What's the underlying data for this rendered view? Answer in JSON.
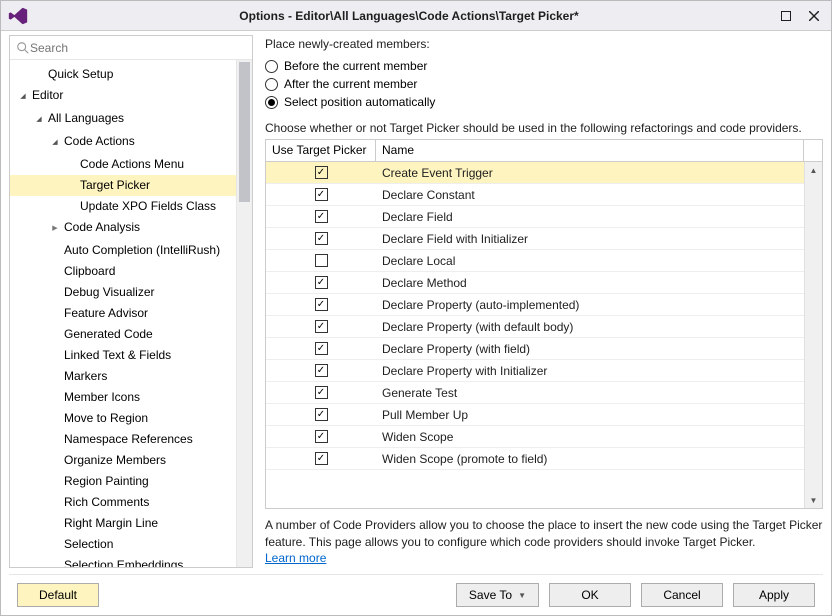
{
  "window": {
    "title": "Options - Editor\\All Languages\\Code Actions\\Target Picker*"
  },
  "search": {
    "placeholder": "Search"
  },
  "tree": {
    "items": [
      {
        "label": "Quick Setup",
        "depth": 1,
        "caret": "none"
      },
      {
        "label": "Editor",
        "depth": 0,
        "caret": "open"
      },
      {
        "label": "All Languages",
        "depth": 1,
        "caret": "open"
      },
      {
        "label": "Code Actions",
        "depth": 2,
        "caret": "open"
      },
      {
        "label": "Code Actions Menu",
        "depth": 3,
        "caret": "none"
      },
      {
        "label": "Target Picker",
        "depth": 3,
        "caret": "none",
        "selected": true
      },
      {
        "label": "Update XPO Fields Class",
        "depth": 3,
        "caret": "none"
      },
      {
        "label": "Code Analysis",
        "depth": 2,
        "caret": "closed"
      },
      {
        "label": "Auto Completion (IntelliRush)",
        "depth": 2,
        "caret": "none"
      },
      {
        "label": "Clipboard",
        "depth": 2,
        "caret": "none"
      },
      {
        "label": "Debug Visualizer",
        "depth": 2,
        "caret": "none"
      },
      {
        "label": "Feature Advisor",
        "depth": 2,
        "caret": "none"
      },
      {
        "label": "Generated Code",
        "depth": 2,
        "caret": "none"
      },
      {
        "label": "Linked Text & Fields",
        "depth": 2,
        "caret": "none"
      },
      {
        "label": "Markers",
        "depth": 2,
        "caret": "none"
      },
      {
        "label": "Member Icons",
        "depth": 2,
        "caret": "none"
      },
      {
        "label": "Move to Region",
        "depth": 2,
        "caret": "none"
      },
      {
        "label": "Namespace References",
        "depth": 2,
        "caret": "none"
      },
      {
        "label": "Organize Members",
        "depth": 2,
        "caret": "none"
      },
      {
        "label": "Region Painting",
        "depth": 2,
        "caret": "none"
      },
      {
        "label": "Rich Comments",
        "depth": 2,
        "caret": "none"
      },
      {
        "label": "Right Margin Line",
        "depth": 2,
        "caret": "none"
      },
      {
        "label": "Selection",
        "depth": 2,
        "caret": "none"
      },
      {
        "label": "Selection Embeddings",
        "depth": 2,
        "caret": "none"
      }
    ]
  },
  "right": {
    "placement_label": "Place newly-created members:",
    "radios": [
      {
        "label": "Before the current member",
        "checked": false
      },
      {
        "label": "After the current member",
        "checked": false
      },
      {
        "label": "Select position automatically",
        "checked": true
      }
    ],
    "choose_label": "Choose whether or not Target Picker should be used in the following refactorings and code providers.",
    "grid": {
      "col_use": "Use Target Picker",
      "col_name": "Name",
      "rows": [
        {
          "name": "Create Event Trigger",
          "checked": true,
          "selected": true
        },
        {
          "name": "Declare Constant",
          "checked": true
        },
        {
          "name": "Declare Field",
          "checked": true
        },
        {
          "name": "Declare Field with Initializer",
          "checked": true
        },
        {
          "name": "Declare Local",
          "checked": false
        },
        {
          "name": "Declare Method",
          "checked": true
        },
        {
          "name": "Declare Property (auto-implemented)",
          "checked": true
        },
        {
          "name": "Declare Property (with default body)",
          "checked": true
        },
        {
          "name": "Declare Property (with field)",
          "checked": true
        },
        {
          "name": "Declare Property with Initializer",
          "checked": true
        },
        {
          "name": "Generate Test",
          "checked": true
        },
        {
          "name": "Pull Member Up",
          "checked": true
        },
        {
          "name": "Widen Scope",
          "checked": true
        },
        {
          "name": "Widen Scope (promote to field)",
          "checked": true
        }
      ]
    },
    "footnote": "A number of Code Providers allow you to choose the place to insert the new code using the Target Picker feature. This page allows you to configure which code providers should invoke Target Picker.",
    "learn_more": "Learn more"
  },
  "buttons": {
    "default": "Default",
    "saveto": "Save To",
    "ok": "OK",
    "cancel": "Cancel",
    "apply": "Apply"
  }
}
